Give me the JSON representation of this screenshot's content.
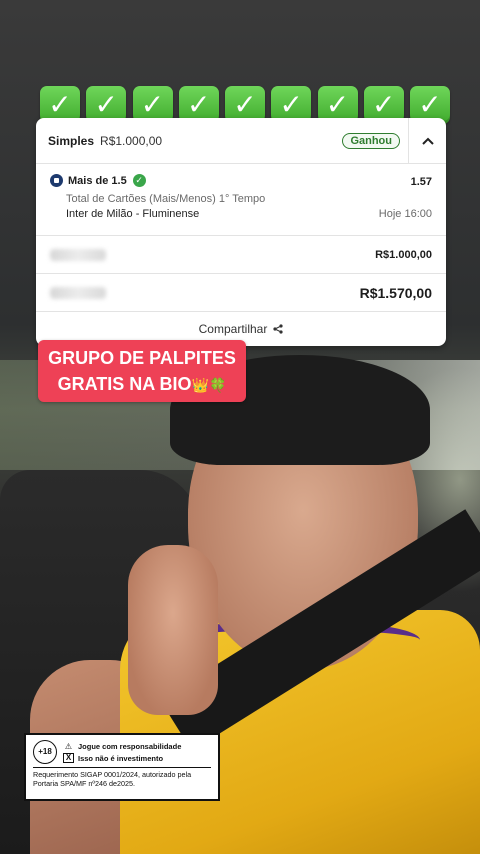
{
  "checkmarks": [
    "✓",
    "✓",
    "✓",
    "✓",
    "✓",
    "✓",
    "✓",
    "✓",
    "✓"
  ],
  "bet_card": {
    "bet_type": "Simples",
    "stake_top": "R$1.000,00",
    "status": "Ganhou",
    "selection": {
      "name": "Mais de 1.5",
      "odds": "1.57",
      "market": "Total de Cartões (Mais/Menos) 1° Tempo",
      "match": "Inter de Milão - Fluminense",
      "kickoff": "Hoje 16:00"
    },
    "stake_amount": "R$1.000,00",
    "return_amount": "R$1.570,00",
    "share_label": "Compartilhar"
  },
  "promo": {
    "line1": "GRUPO DE PALPITES",
    "line2": "GRATIS NA BIO",
    "emojis": "👑🍀"
  },
  "responsible": {
    "age": "+18",
    "line1": "Jogue com responsabilidade",
    "line2": "Isso não é investimento",
    "legal": "Requerimento SIGAP 0001/2024, autorizado pela Portaria SPA/MF nº246 de2025."
  },
  "colors": {
    "check_green": "#4cc13a",
    "status_green": "#2f7d2f",
    "promo_red": "#ee4156"
  }
}
